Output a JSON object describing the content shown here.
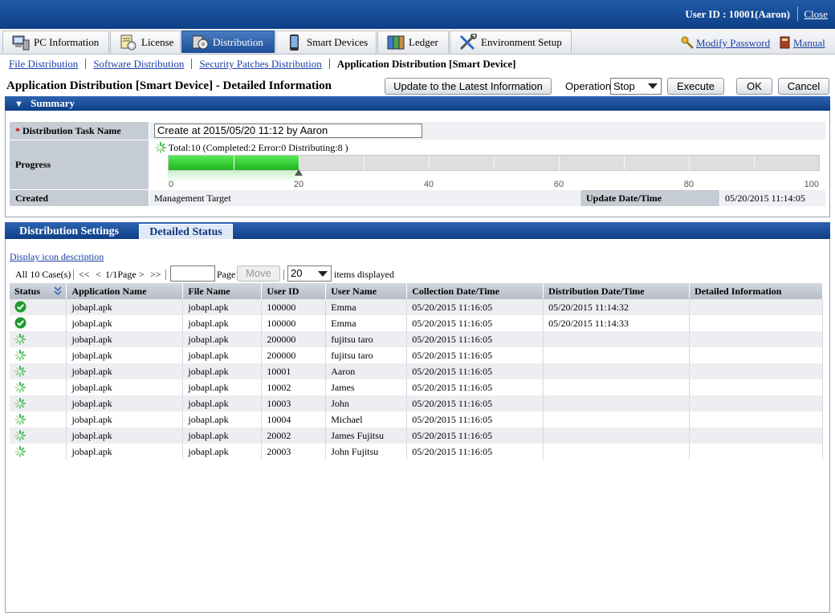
{
  "topbar": {
    "user_id": "User ID : 10001(Aaron)",
    "close": "Close"
  },
  "menu": {
    "tabs": [
      {
        "label": "PC Information",
        "icon": "pc-icon"
      },
      {
        "label": "License",
        "icon": "license-icon"
      },
      {
        "label": "Distribution",
        "icon": "distribution-icon",
        "active": true
      },
      {
        "label": "Smart Devices",
        "icon": "smartphone-icon"
      },
      {
        "label": "Ledger",
        "icon": "ledger-icon"
      },
      {
        "label": "Environment Setup",
        "icon": "tools-icon"
      }
    ],
    "modify_password": "Modify Password",
    "manual": "Manual"
  },
  "subnav": {
    "links": [
      "File Distribution",
      "Software Distribution",
      "Security Patches Distribution"
    ],
    "current": "Application Distribution [Smart Device]"
  },
  "page": {
    "title": "Application Distribution [Smart Device] - Detailed Information"
  },
  "toolbar": {
    "update": "Update to the Latest Information",
    "operation_label": "Operation:",
    "operation_value": "Stop",
    "execute": "Execute",
    "ok": "OK",
    "cancel": "Cancel"
  },
  "summary": {
    "title": "Summary",
    "task_name_label": "Distribution Task Name",
    "task_name_required": "*",
    "task_name_value": "Create at 2015/05/20 11:12 by Aaron",
    "progress_label": "Progress",
    "progress_text": "Total:10  (Completed:2  Error:0  Distributing:8 )",
    "progress_percent": 20,
    "axis_labels": [
      "0",
      "20",
      "40",
      "60",
      "80",
      "100"
    ],
    "created_label": "Created",
    "created_value": "Management Target",
    "update_label": "Update Date/Time",
    "update_value": "05/20/2015 11:14:05"
  },
  "tabs": {
    "settings": "Distribution Settings",
    "status": "Detailed Status"
  },
  "list": {
    "icon_desc": "Display icon description",
    "total": "All 10 Case(s)",
    "first": "<<",
    "prev": "<",
    "page_info": "1/1Page",
    "next": ">",
    "last": ">>",
    "page_label": "Page",
    "move": "Move",
    "per_page": "20",
    "items_displayed": "items displayed"
  },
  "table": {
    "headers": [
      "Status",
      "Application Name",
      "File Name",
      "User ID",
      "User Name",
      "Collection Date/Time",
      "Distribution Date/Time",
      "Detailed Information"
    ],
    "rows": [
      {
        "status": "completed",
        "app": "jobapl.apk",
        "file": "jobapl.apk",
        "user_id": "100000",
        "user_name": "Emma",
        "collected": "05/20/2015 11:16:05",
        "distributed": "05/20/2015 11:14:32",
        "detail": ""
      },
      {
        "status": "completed",
        "app": "jobapl.apk",
        "file": "jobapl.apk",
        "user_id": "100000",
        "user_name": "Emma",
        "collected": "05/20/2015 11:16:05",
        "distributed": "05/20/2015 11:14:33",
        "detail": ""
      },
      {
        "status": "distributing",
        "app": "jobapl.apk",
        "file": "jobapl.apk",
        "user_id": "200000",
        "user_name": "fujitsu taro",
        "collected": "05/20/2015 11:16:05",
        "distributed": "",
        "detail": ""
      },
      {
        "status": "distributing",
        "app": "jobapl.apk",
        "file": "jobapl.apk",
        "user_id": "200000",
        "user_name": "fujitsu taro",
        "collected": "05/20/2015 11:16:05",
        "distributed": "",
        "detail": ""
      },
      {
        "status": "distributing",
        "app": "jobapl.apk",
        "file": "jobapl.apk",
        "user_id": "10001",
        "user_name": "Aaron",
        "collected": "05/20/2015 11:16:05",
        "distributed": "",
        "detail": ""
      },
      {
        "status": "distributing",
        "app": "jobapl.apk",
        "file": "jobapl.apk",
        "user_id": "10002",
        "user_name": "James",
        "collected": "05/20/2015 11:16:05",
        "distributed": "",
        "detail": ""
      },
      {
        "status": "distributing",
        "app": "jobapl.apk",
        "file": "jobapl.apk",
        "user_id": "10003",
        "user_name": "John",
        "collected": "05/20/2015 11:16:05",
        "distributed": "",
        "detail": ""
      },
      {
        "status": "distributing",
        "app": "jobapl.apk",
        "file": "jobapl.apk",
        "user_id": "10004",
        "user_name": "Michael",
        "collected": "05/20/2015 11:16:05",
        "distributed": "",
        "detail": ""
      },
      {
        "status": "distributing",
        "app": "jobapl.apk",
        "file": "jobapl.apk",
        "user_id": "20002",
        "user_name": "James Fujitsu",
        "collected": "05/20/2015 11:16:05",
        "distributed": "",
        "detail": ""
      },
      {
        "status": "distributing",
        "app": "jobapl.apk",
        "file": "jobapl.apk",
        "user_id": "20003",
        "user_name": "John Fujitsu",
        "collected": "05/20/2015 11:16:05",
        "distributed": "",
        "detail": ""
      }
    ]
  }
}
